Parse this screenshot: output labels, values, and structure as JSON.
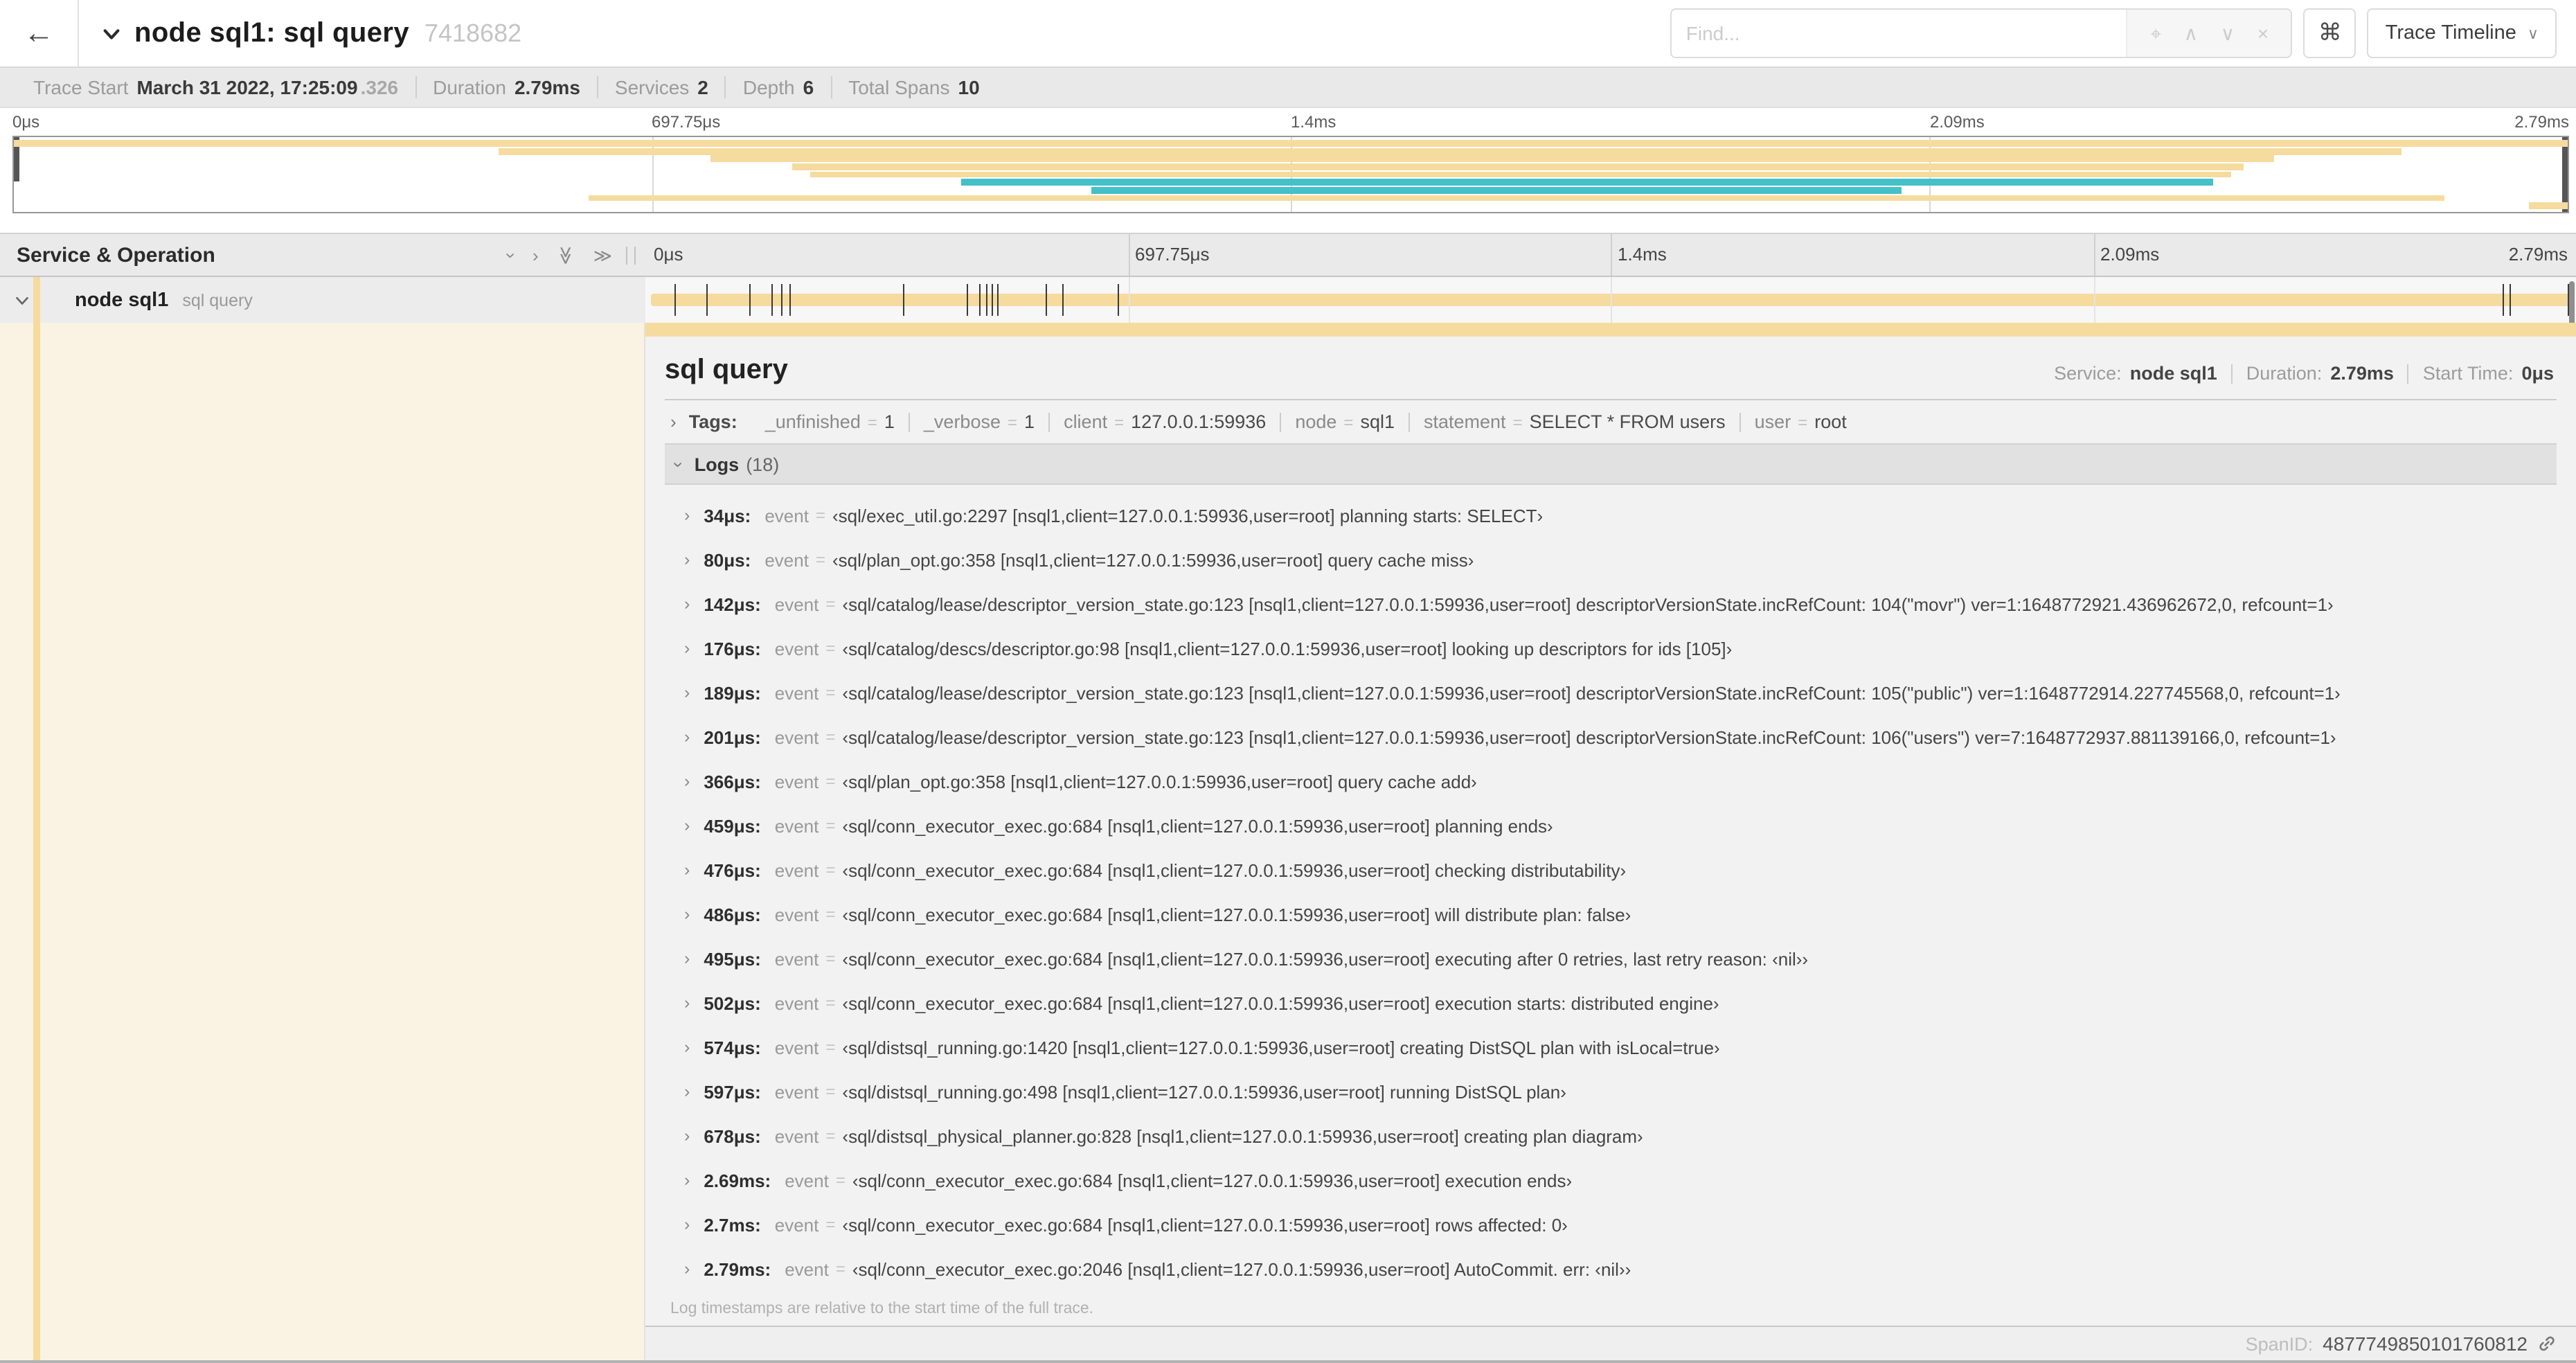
{
  "header": {
    "back_icon": "←",
    "title": "node sql1: sql query",
    "trace_id": "7418682",
    "find": {
      "placeholder": "Find...",
      "locate_icon": "⌖",
      "prev_icon": "∧",
      "next_icon": "∨",
      "clear_icon": "×"
    },
    "shortcuts_icon": "⌘",
    "view_selector_label": "Trace Timeline"
  },
  "trace_info": {
    "items": [
      {
        "label": "Trace Start",
        "value": "March 31 2022, 17:25:09",
        "suffix": ".326"
      },
      {
        "label": "Duration",
        "value": "2.79ms",
        "suffix": ""
      },
      {
        "label": "Services",
        "value": "2",
        "suffix": ""
      },
      {
        "label": "Depth",
        "value": "6",
        "suffix": ""
      },
      {
        "label": "Total Spans",
        "value": "10",
        "suffix": ""
      }
    ]
  },
  "timeline": {
    "axis_ticks": [
      "0μs",
      "697.75μs",
      "1.4ms",
      "2.09ms",
      "2.79ms"
    ],
    "duration_us": 2790,
    "log_marker_times_us": [
      34,
      80,
      142,
      176,
      189,
      201,
      366,
      459,
      476,
      486,
      495,
      502,
      574,
      597,
      678,
      2690,
      2700,
      2790
    ],
    "minimap_spans": [
      {
        "start": 0.0,
        "end": 1.0,
        "color": "tan"
      },
      {
        "start": 0.19,
        "end": 0.935,
        "color": "tan"
      },
      {
        "start": 0.273,
        "end": 0.885,
        "color": "tan"
      },
      {
        "start": 0.305,
        "end": 0.873,
        "color": "tan"
      },
      {
        "start": 0.312,
        "end": 0.868,
        "color": "tan"
      },
      {
        "start": 0.371,
        "end": 0.861,
        "color": "teal"
      },
      {
        "start": 0.422,
        "end": 0.739,
        "color": "teal"
      },
      {
        "start": 0.225,
        "end": 0.952,
        "color": "tan"
      },
      {
        "start": 0.985,
        "end": 1.0,
        "color": "tan"
      }
    ],
    "colors": {
      "span_tan": "#F6DB9E",
      "span_teal": "#44C0C8",
      "selected_bg": "#FAF3E3"
    }
  },
  "span_table": {
    "header": "Service & Operation",
    "row": {
      "service": "node sql1",
      "operation": "sql query"
    }
  },
  "detail": {
    "title": "sql query",
    "meta": [
      {
        "label": "Service:",
        "value": "node sql1"
      },
      {
        "label": "Duration:",
        "value": "2.79ms"
      },
      {
        "label": "Start Time:",
        "value": "0μs"
      }
    ],
    "tags_label": "Tags:",
    "tags": [
      {
        "key": "_unfinished",
        "value": "1"
      },
      {
        "key": "_verbose",
        "value": "1"
      },
      {
        "key": "client",
        "value": "127.0.0.1:59936"
      },
      {
        "key": "node",
        "value": "sql1"
      },
      {
        "key": "statement",
        "value": "SELECT * FROM users"
      },
      {
        "key": "user",
        "value": "root"
      }
    ],
    "logs_label": "Logs",
    "logs_count": "(18)",
    "logs": [
      {
        "time": "34μs:",
        "key": "event",
        "value": "‹sql/exec_util.go:2297 [nsql1,client=127.0.0.1:59936,user=root] planning starts: SELECT›"
      },
      {
        "time": "80μs:",
        "key": "event",
        "value": "‹sql/plan_opt.go:358 [nsql1,client=127.0.0.1:59936,user=root] query cache miss›"
      },
      {
        "time": "142μs:",
        "key": "event",
        "value": "‹sql/catalog/lease/descriptor_version_state.go:123 [nsql1,client=127.0.0.1:59936,user=root] descriptorVersionState.incRefCount: 104(\"movr\") ver=1:1648772921.436962672,0, refcount=1›"
      },
      {
        "time": "176μs:",
        "key": "event",
        "value": "‹sql/catalog/descs/descriptor.go:98 [nsql1,client=127.0.0.1:59936,user=root] looking up descriptors for ids [105]›"
      },
      {
        "time": "189μs:",
        "key": "event",
        "value": "‹sql/catalog/lease/descriptor_version_state.go:123 [nsql1,client=127.0.0.1:59936,user=root] descriptorVersionState.incRefCount: 105(\"public\") ver=1:1648772914.227745568,0, refcount=1›"
      },
      {
        "time": "201μs:",
        "key": "event",
        "value": "‹sql/catalog/lease/descriptor_version_state.go:123 [nsql1,client=127.0.0.1:59936,user=root] descriptorVersionState.incRefCount: 106(\"users\") ver=7:1648772937.881139166,0, refcount=1›"
      },
      {
        "time": "366μs:",
        "key": "event",
        "value": "‹sql/plan_opt.go:358 [nsql1,client=127.0.0.1:59936,user=root] query cache add›"
      },
      {
        "time": "459μs:",
        "key": "event",
        "value": "‹sql/conn_executor_exec.go:684 [nsql1,client=127.0.0.1:59936,user=root] planning ends›"
      },
      {
        "time": "476μs:",
        "key": "event",
        "value": "‹sql/conn_executor_exec.go:684 [nsql1,client=127.0.0.1:59936,user=root] checking distributability›"
      },
      {
        "time": "486μs:",
        "key": "event",
        "value": "‹sql/conn_executor_exec.go:684 [nsql1,client=127.0.0.1:59936,user=root] will distribute plan: false›"
      },
      {
        "time": "495μs:",
        "key": "event",
        "value": "‹sql/conn_executor_exec.go:684 [nsql1,client=127.0.0.1:59936,user=root] executing after 0 retries, last retry reason: ‹nil››"
      },
      {
        "time": "502μs:",
        "key": "event",
        "value": "‹sql/conn_executor_exec.go:684 [nsql1,client=127.0.0.1:59936,user=root] execution starts: distributed engine›"
      },
      {
        "time": "574μs:",
        "key": "event",
        "value": "‹sql/distsql_running.go:1420 [nsql1,client=127.0.0.1:59936,user=root] creating DistSQL plan with isLocal=true›"
      },
      {
        "time": "597μs:",
        "key": "event",
        "value": "‹sql/distsql_running.go:498 [nsql1,client=127.0.0.1:59936,user=root] running DistSQL plan›"
      },
      {
        "time": "678μs:",
        "key": "event",
        "value": "‹sql/distsql_physical_planner.go:828 [nsql1,client=127.0.0.1:59936,user=root] creating plan diagram›"
      },
      {
        "time": "2.69ms:",
        "key": "event",
        "value": "‹sql/conn_executor_exec.go:684 [nsql1,client=127.0.0.1:59936,user=root] execution ends›"
      },
      {
        "time": "2.7ms:",
        "key": "event",
        "value": "‹sql/conn_executor_exec.go:684 [nsql1,client=127.0.0.1:59936,user=root] rows affected: 0›"
      },
      {
        "time": "2.79ms:",
        "key": "event",
        "value": "‹sql/conn_executor_exec.go:2046 [nsql1,client=127.0.0.1:59936,user=root] AutoCommit. err: ‹nil››"
      }
    ],
    "footer_note": "Log timestamps are relative to the start time of the full trace.",
    "span_id_label": "SpanID:",
    "span_id": "4877749850101760812"
  }
}
